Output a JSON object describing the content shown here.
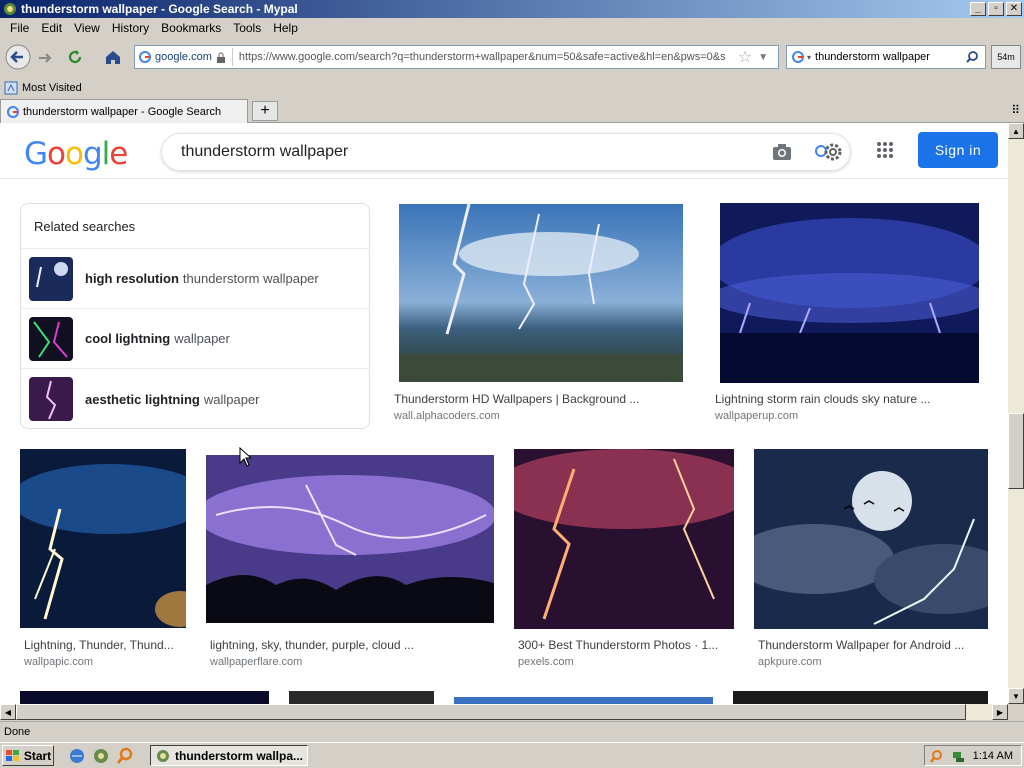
{
  "window": {
    "title": "thunderstorm wallpaper - Google Search - Mypal"
  },
  "menu": [
    "File",
    "Edit",
    "View",
    "History",
    "Bookmarks",
    "Tools",
    "Help"
  ],
  "nav": {
    "site": "google.com",
    "url": "https://www.google.com/search?q=thunderstorm+wallpaper&num=50&safe=active&hl=en&pws=0&s",
    "search_value": "thunderstorm wallpaper",
    "ext_label": "54m"
  },
  "bookmarks": {
    "most_visited": "Most Visited"
  },
  "tab": {
    "title": "thunderstorm wallpaper - Google Search",
    "new_tab": "+"
  },
  "google": {
    "logo": [
      "G",
      "o",
      "o",
      "g",
      "l",
      "e"
    ],
    "logo_colors": [
      "#4285F4",
      "#EA4335",
      "#FBBC05",
      "#4285F4",
      "#34A853",
      "#EA4335"
    ],
    "query": "thunderstorm wallpaper",
    "signin": "Sign in"
  },
  "related": {
    "title": "Related searches",
    "items": [
      {
        "bold": "high resolution",
        "rest": "thunderstorm wallpaper"
      },
      {
        "bold": "cool lightning",
        "rest": "wallpaper"
      },
      {
        "bold": "aesthetic lightning",
        "rest": "wallpaper"
      }
    ]
  },
  "results": [
    {
      "caption": "Thunderstorm HD Wallpapers | Background ...",
      "source": "wall.alphacoders.com"
    },
    {
      "caption": "Lightning storm rain clouds sky nature ...",
      "source": "wallpaperup.com"
    },
    {
      "caption": "Lightning, Thunder, Thund...",
      "source": "wallpapic.com"
    },
    {
      "caption": "lightning, sky, thunder, purple, cloud ...",
      "source": "wallpaperflare.com"
    },
    {
      "caption": "300+ Best Thunderstorm Photos · 1...",
      "source": "pexels.com"
    },
    {
      "caption": "Thunderstorm Wallpaper for Android ...",
      "source": "apkpure.com"
    }
  ],
  "status": {
    "text": "Done"
  },
  "taskbar": {
    "start": "Start",
    "task": "thunderstorm wallpa...",
    "clock": "1:14 AM"
  }
}
